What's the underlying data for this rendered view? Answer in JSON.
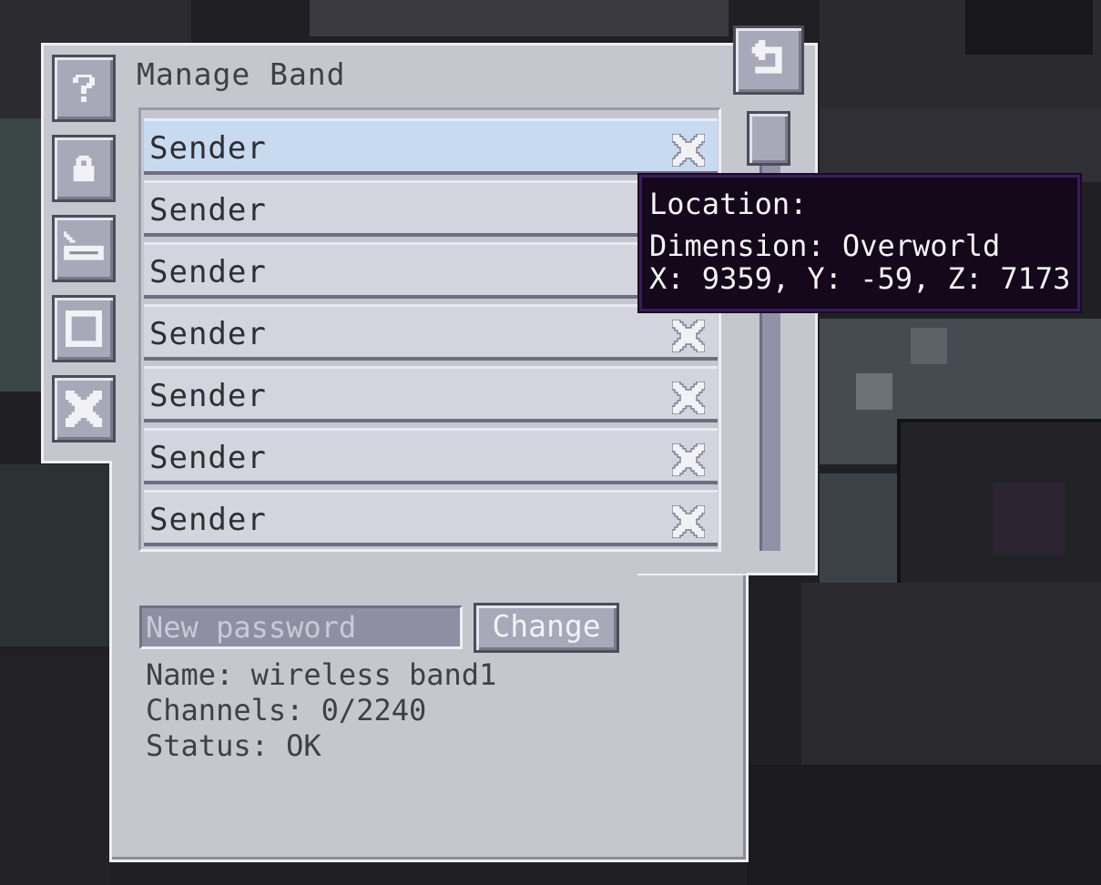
{
  "window": {
    "title": "Manage Band"
  },
  "side_buttons": [
    {
      "icon": "question-icon"
    },
    {
      "icon": "lock-icon"
    },
    {
      "icon": "antenna-icon"
    },
    {
      "icon": "frame-icon"
    },
    {
      "icon": "close-icon"
    }
  ],
  "back_button": {
    "icon": "back-arrow-icon"
  },
  "list": {
    "rows": [
      {
        "label": "Sender",
        "selected": true
      },
      {
        "label": "Sender"
      },
      {
        "label": "Sender"
      },
      {
        "label": "Sender"
      },
      {
        "label": "Sender"
      },
      {
        "label": "Sender"
      },
      {
        "label": "Sender"
      }
    ],
    "remove_icon": "x-icon"
  },
  "password": {
    "placeholder": "New password",
    "value": ""
  },
  "change_button": {
    "label": "Change"
  },
  "info": {
    "name": "Name: wireless band1",
    "channels": "Channels: 0/2240",
    "status": "Status: OK"
  },
  "tooltip": {
    "line1": "Location:",
    "line2": "Dimension: Overworld",
    "line3": "X: 9359, Y: -59, Z: 7173"
  },
  "colors": {
    "panel": "#c6c6cf",
    "selected_row": "#c8daf0",
    "tooltip_bg": "#14081a",
    "tooltip_border": "#3a1a5c"
  }
}
